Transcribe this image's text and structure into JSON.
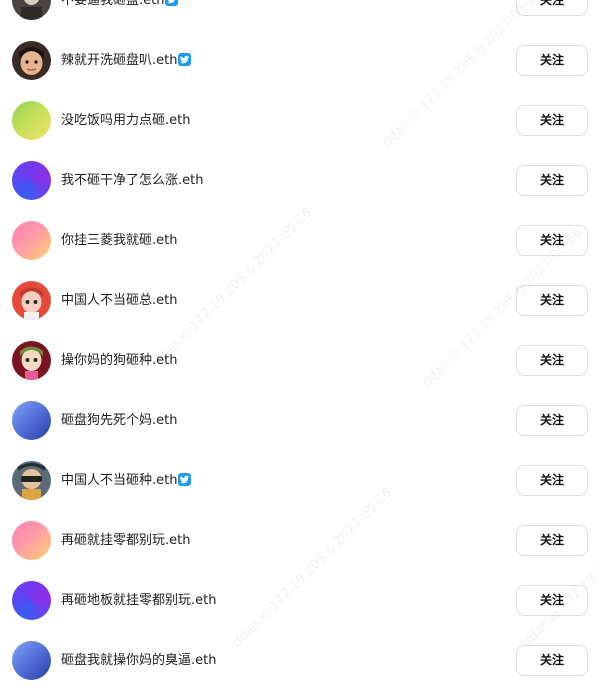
{
  "follow_label": "关注",
  "accounts": [
    {
      "name": "不要逼我砸盘.eth",
      "verified": true,
      "avatar": "photo-avatar-dark"
    },
    {
      "name": "辣就开洗砸盘叭.eth",
      "verified": true,
      "avatar": "cartoon-avatar-boy"
    },
    {
      "name": "没吃饭吗用力点砸.eth",
      "verified": false,
      "avatar": "gradient-avatar-green"
    },
    {
      "name": "我不砸干净了怎么涨.eth",
      "verified": false,
      "avatar": "gradient-avatar-blue-purple"
    },
    {
      "name": "你挂三菱我就砸.eth",
      "verified": false,
      "avatar": "gradient-avatar-pink-yellow"
    },
    {
      "name": "中国人不当砸总.eth",
      "verified": false,
      "avatar": "cartoon-avatar-red"
    },
    {
      "name": "操你妈的狗砸种.eth",
      "verified": false,
      "avatar": "cartoon-avatar-dark-red"
    },
    {
      "name": "砸盘狗先死个妈.eth",
      "verified": false,
      "avatar": "gradient-avatar-blue-dark"
    },
    {
      "name": "中国人不当砸种.eth",
      "verified": true,
      "avatar": "photo-avatar-masked"
    },
    {
      "name": "再砸就挂零都别玩.eth",
      "verified": false,
      "avatar": "gradient-avatar-pink-yellow"
    },
    {
      "name": "再砸地板就挂零都别玩.eth",
      "verified": false,
      "avatar": "gradient-avatar-blue-purple"
    },
    {
      "name": "砸盘我就操你妈的臭逼.eth",
      "verified": false,
      "avatar": "gradient-avatar-blue-dark"
    }
  ],
  "watermark_text": "ddao.io 172.19.205.6 2023-05-26",
  "colors": {
    "text": "#1f1f1f",
    "button_border": "#dcdcdc",
    "verified_blue": "#1d9bf0"
  }
}
